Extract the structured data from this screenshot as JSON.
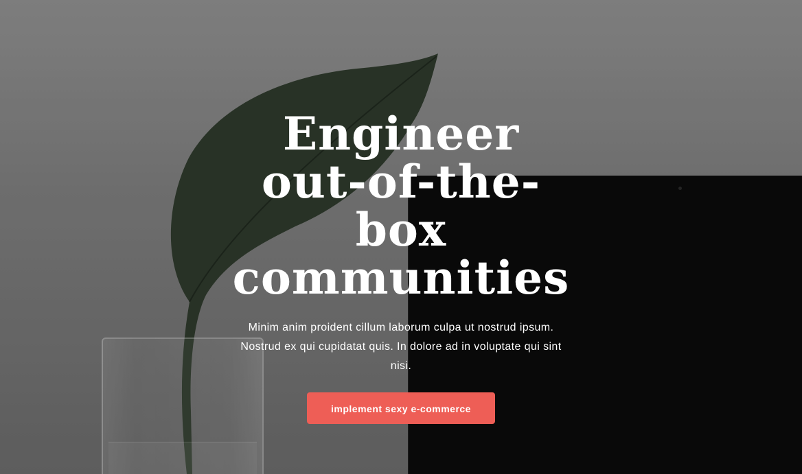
{
  "hero": {
    "headline": "Engineer out-of-the-box communities",
    "subtext": "Minim anim proident cillum laborum culpa ut nostrud ipsum. Nostrud ex qui cupidatat quis. In dolore ad in voluptate qui sint nisi.",
    "cta_label": "implement sexy e-commerce"
  },
  "colors": {
    "cta_background": "#ee5e56",
    "text": "#ffffff",
    "monitor": "#0b0b0b"
  }
}
